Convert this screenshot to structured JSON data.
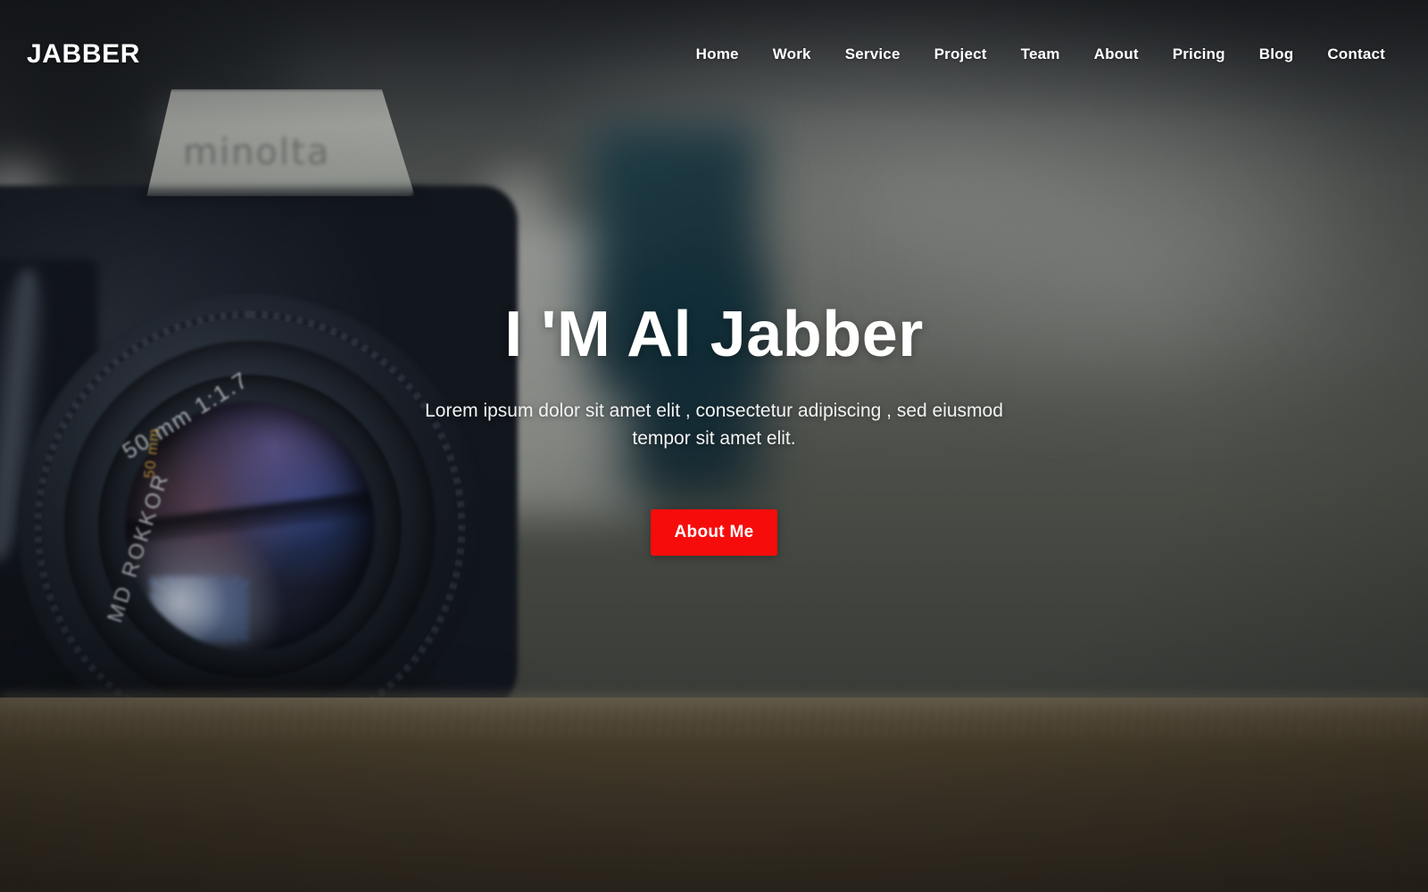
{
  "site": {
    "logo": "JABBER"
  },
  "nav": {
    "items": [
      {
        "label": "Home"
      },
      {
        "label": "Work"
      },
      {
        "label": "Service"
      },
      {
        "label": "Project"
      },
      {
        "label": "Team"
      },
      {
        "label": "About"
      },
      {
        "label": "Pricing"
      },
      {
        "label": "Blog"
      },
      {
        "label": "Contact"
      }
    ]
  },
  "hero": {
    "title": "I 'M Al Jabber",
    "subtitle": "Lorem ipsum dolor sit amet elit , consectetur adipiscing , sed eiusmod tempor sit amet elit.",
    "cta_label": "About Me"
  },
  "background": {
    "description": "blurred vintage minolta slr camera on a wooden desk",
    "camera_brand": "minolta",
    "lens_markings": {
      "aperture": "50 mm 1:1.7",
      "lens_name": "MD ROKKOR",
      "mount_brand": "MINOLTA",
      "focal_marker": "50 mm"
    }
  },
  "colors": {
    "accent": "#f70c0c",
    "text_on_hero": "#ffffff",
    "wall": "#4d5049",
    "desk": "#4a3e2b",
    "camera_body": "#141a24",
    "teal_object": "#16343f"
  }
}
